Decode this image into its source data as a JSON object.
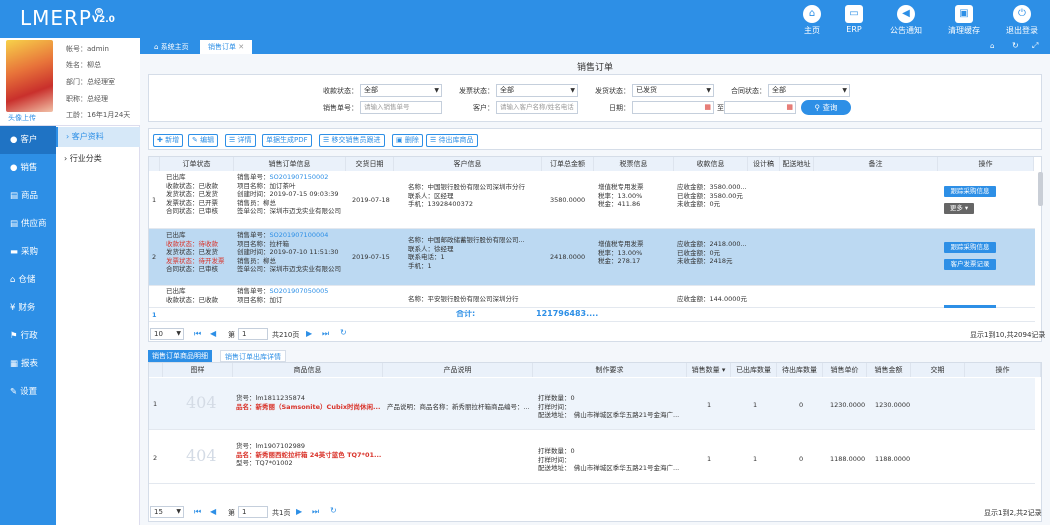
{
  "app": {
    "logo": "LMERP",
    "version": "V2.0"
  },
  "topbar": [
    {
      "label": "主页",
      "icon": "home-icon"
    },
    {
      "label": "ERP",
      "icon": "monitor-icon"
    },
    {
      "label": "公告通知",
      "icon": "speaker-icon"
    },
    {
      "label": "清理缓存",
      "icon": "trash-icon"
    },
    {
      "label": "退出登录",
      "icon": "power-icon"
    }
  ],
  "profile": {
    "avatar_label": "头像上传",
    "account": "帐号：admin",
    "name": "姓名：柳总",
    "dept": "部门：总经理室",
    "title": "职称：总经理",
    "seniority": "工龄：16年1月24天"
  },
  "nav": [
    {
      "label": "客户",
      "icon": "user-icon"
    },
    {
      "label": "销售",
      "icon": "users-icon"
    },
    {
      "label": "商品",
      "icon": "card-icon"
    },
    {
      "label": "供应商",
      "icon": "card-icon"
    },
    {
      "label": "采购",
      "icon": "truck-icon"
    },
    {
      "label": "仓储",
      "icon": "house-icon"
    },
    {
      "label": "财务",
      "icon": "yen-icon"
    },
    {
      "label": "行政",
      "icon": "flag-icon"
    },
    {
      "label": "报表",
      "icon": "doc-icon"
    },
    {
      "label": "设置",
      "icon": "wrench-icon"
    }
  ],
  "subnav": [
    "客户资料",
    "行业分类"
  ],
  "tabs": {
    "home": "系统主页",
    "current": "销售订单"
  },
  "page_title": "销售订单",
  "filters": {
    "receipt_status_label": "收款状态：",
    "receipt_status": "全部",
    "invoice_status_label": "发票状态：",
    "invoice_status": "全部",
    "ship_status_label": "发货状态：",
    "ship_status": "已发货",
    "contract_status_label": "合同状态：",
    "contract_status": "全部",
    "order_no_label": "销售单号：",
    "order_no_placeholder": "请输入销售单号",
    "customer_label": "客户：",
    "customer_placeholder": "请输入客户名称/姓名电话",
    "date_label": "日期：",
    "date_to": "至",
    "query": "查询"
  },
  "toolbar": [
    "新增",
    "编辑",
    "详情",
    "单据生成PDF",
    "移交销售员跟进",
    "删除",
    "待出库商品"
  ],
  "table": {
    "headers": [
      "订单状态",
      "销售订单信息",
      "交货日期",
      "客户信息",
      "订单总金额",
      "税票信息",
      "收款信息",
      "设计稿",
      "配送地址",
      "备注",
      "操作"
    ],
    "rows": [
      {
        "no": "1",
        "status": [
          "已出库",
          "收款状态：已收款",
          "发货状态：已发货",
          "发票状态：已开票",
          "合同状态：已审核"
        ],
        "order": [
          "销售单号：",
          "SO201907150002",
          "项目名称：加订茶叶",
          "创建时间：2019-07-15 09:03:39",
          "销售员：柳总",
          "签单公司：深圳市迈戈实业有限公司"
        ],
        "delivery": "2019-07-18",
        "customer": [
          "名称：中国银行股份有限公司深圳市分行",
          "联系人：区经理",
          "手机：13928400372"
        ],
        "amount": "3580.0000",
        "tax": [
          "增值税专用发票",
          "税率：13.00%",
          "税金：411.86"
        ],
        "pay": [
          "应收金额：3580.000...",
          "已收金额：3580.00元",
          "未收金额：0元"
        ],
        "actions": [
          "跟踪采购信息",
          "更多"
        ]
      },
      {
        "no": "2",
        "status": [
          "已出库",
          "收款状态：待收款",
          "发货状态：已发货",
          "发票状态：待开发票",
          "合同状态：已审核"
        ],
        "order": [
          "销售单号：",
          "SO201907100004",
          "项目名称：拉杆箱",
          "创建时间：2019-07-10 11:51:30",
          "销售员：柳总",
          "签单公司：深圳市迈戈实业有限公司"
        ],
        "delivery": "2019-07-15",
        "customer": [
          "名称：中国邮政储蓄银行股份有限公司...",
          "联系人：徐经理",
          "联系电话：1",
          "手机：1"
        ],
        "amount": "2418.0000",
        "tax": [
          "增值税专用发票",
          "税率：13.00%",
          "税金：278.17"
        ],
        "pay": [
          "应收金额：2418.000...",
          "已收金额：0元",
          "未收金额：2418元"
        ],
        "actions": [
          "跟踪采购信息",
          "客户发票记录"
        ]
      },
      {
        "no": "",
        "status": [
          "已出库",
          "收款状态：已收款"
        ],
        "order": [
          "销售单号：",
          "SO201907050005",
          "项目名称：加订"
        ],
        "delivery": "",
        "customer": [
          "名称：平安银行股份有限公司深圳分行"
        ],
        "amount": "",
        "tax": [],
        "pay": [
          "应收金额：144.0000元"
        ],
        "actions": []
      }
    ],
    "footer": {
      "no": "1",
      "label": "合计:",
      "total": "121796483...."
    },
    "pager": {
      "size": "10",
      "page": "1",
      "total_pages": "共210页",
      "summary": "显示1到10,共2094记录",
      "prefix": "第"
    }
  },
  "lower_tabs": [
    "销售订单商品明细",
    "销售订单出库详情"
  ],
  "lower": {
    "headers": [
      "图样",
      "商品信息",
      "产品说明",
      "制作要求",
      "销售数量",
      "已出库数量",
      "待出库数量",
      "销售单价",
      "销售金额",
      "交期",
      "操作"
    ],
    "rows": [
      {
        "no": "1",
        "img": "404",
        "info": [
          "货号：lm1811235874",
          "品名：新秀丽（Samsonite）Cubix时尚休闲..."
        ],
        "desc": "产品说明：商品名称：新秀丽拉杆箱商品编号：...",
        "req": [
          "打样数量：0",
          "打样时间：",
          "配送地址：　佛山市禅城区季华五路21号金海广..."
        ],
        "qty": "1",
        "out": "1",
        "pending": "0",
        "price": "1230.0000",
        "amount": "1230.0000"
      },
      {
        "no": "2",
        "img": "404",
        "info": [
          "货号：lm1907102989",
          "品名：新秀丽西蛇拉杆箱 24英寸蓝色 TQ7*01...",
          "型号：TQ7*01002"
        ],
        "desc": "",
        "req": [
          "打样数量：0",
          "打样时间：",
          "配送地址：　佛山市禅城区季华五路21号金海广..."
        ],
        "qty": "1",
        "out": "1",
        "pending": "0",
        "price": "1188.0000",
        "amount": "1188.0000"
      }
    ],
    "pager": {
      "size": "15",
      "page": "1",
      "total_pages": "共1页",
      "summary": "显示1到2,共2记录",
      "prefix": "第"
    }
  }
}
